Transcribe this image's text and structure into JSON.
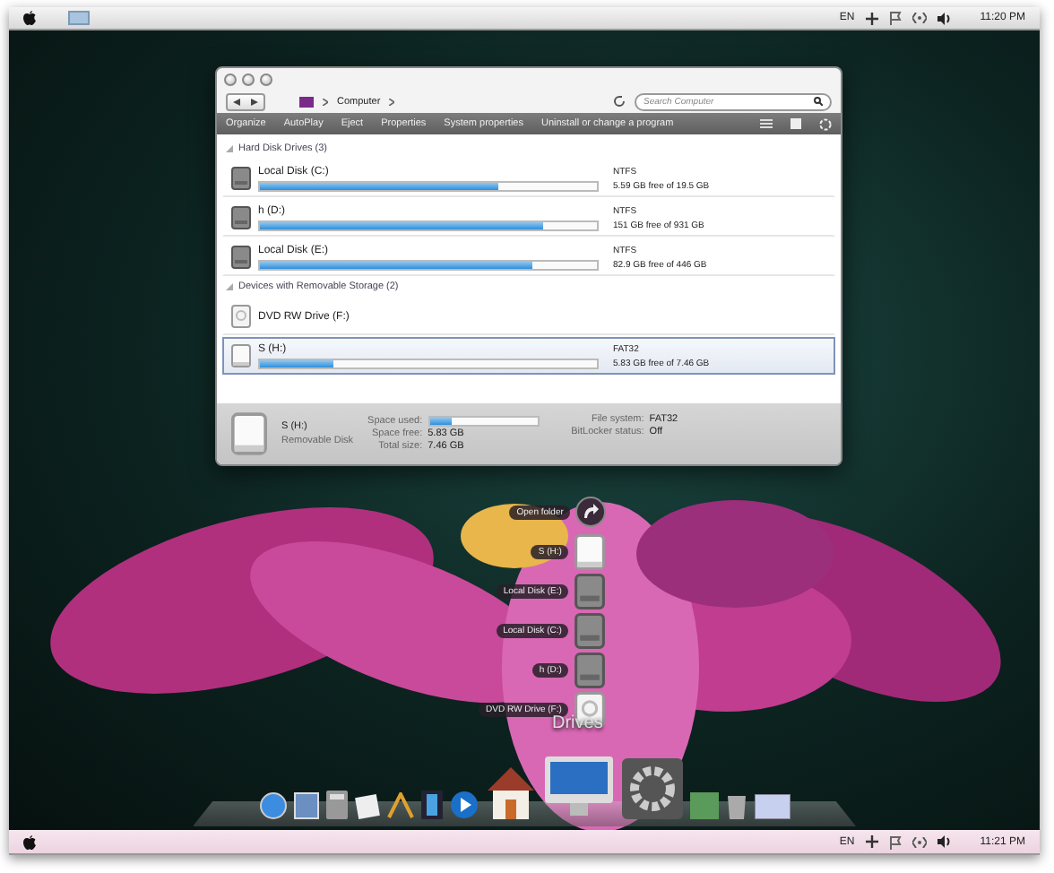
{
  "menu_bar": {
    "language": "EN",
    "clock": "11:20 PM"
  },
  "explorer": {
    "address": {
      "crumb": "Computer",
      "search_placeholder": "Search Computer"
    },
    "toolbar": [
      "Organize",
      "AutoPlay",
      "Eject",
      "Properties",
      "System properties",
      "Uninstall or change a program"
    ],
    "groups": [
      {
        "title": "Hard Disk Drives (3)",
        "drives": [
          {
            "name": "Local Disk (C:)",
            "kind": "hdd",
            "file_system": "NTFS",
            "free": "5.59 GB free of 19.5 GB",
            "level": 0.71,
            "selected": false
          },
          {
            "name": "h (D:)",
            "kind": "hdd",
            "file_system": "NTFS",
            "free": "151 GB free of 931 GB",
            "level": 0.84,
            "selected": false
          },
          {
            "name": "Local Disk (E:)",
            "kind": "hdd",
            "file_system": "NTFS",
            "free": "82.9 GB free of 446 GB",
            "level": 0.81,
            "selected": false
          }
        ]
      },
      {
        "title": "Devices with Removable Storage (2)",
        "drives": [
          {
            "name": "DVD RW Drive (F:)",
            "kind": "optical",
            "selected": false
          },
          {
            "name": "S (H:)",
            "kind": "removable",
            "file_system": "FAT32",
            "free": "5.83 GB free of 7.46 GB",
            "level": 0.22,
            "selected": true
          }
        ]
      }
    ],
    "details": {
      "name": "S (H:)",
      "type": "Removable Disk",
      "left": [
        {
          "label": "Space used:",
          "level": 0.21
        },
        {
          "label": "Space free:",
          "value": "5.83 GB"
        },
        {
          "label": "Total size:",
          "value": "7.46 GB"
        }
      ],
      "right": [
        {
          "label": "File system:",
          "value": "FAT32"
        },
        {
          "label": "BitLocker status:",
          "value": "Off"
        }
      ]
    }
  },
  "stack": {
    "title": "Drives",
    "items": [
      {
        "label": "Open folder",
        "kind": "action"
      },
      {
        "label": "S (H:)",
        "kind": "removable"
      },
      {
        "label": "Local Disk (E:)",
        "kind": "hdd"
      },
      {
        "label": "Local Disk (C:)",
        "kind": "hdd"
      },
      {
        "label": "h (D:)",
        "kind": "hdd"
      },
      {
        "label": "DVD RW Drive (F:)",
        "kind": "optical"
      }
    ]
  },
  "taskbar": {
    "language": "EN",
    "clock": "11:21 PM"
  }
}
